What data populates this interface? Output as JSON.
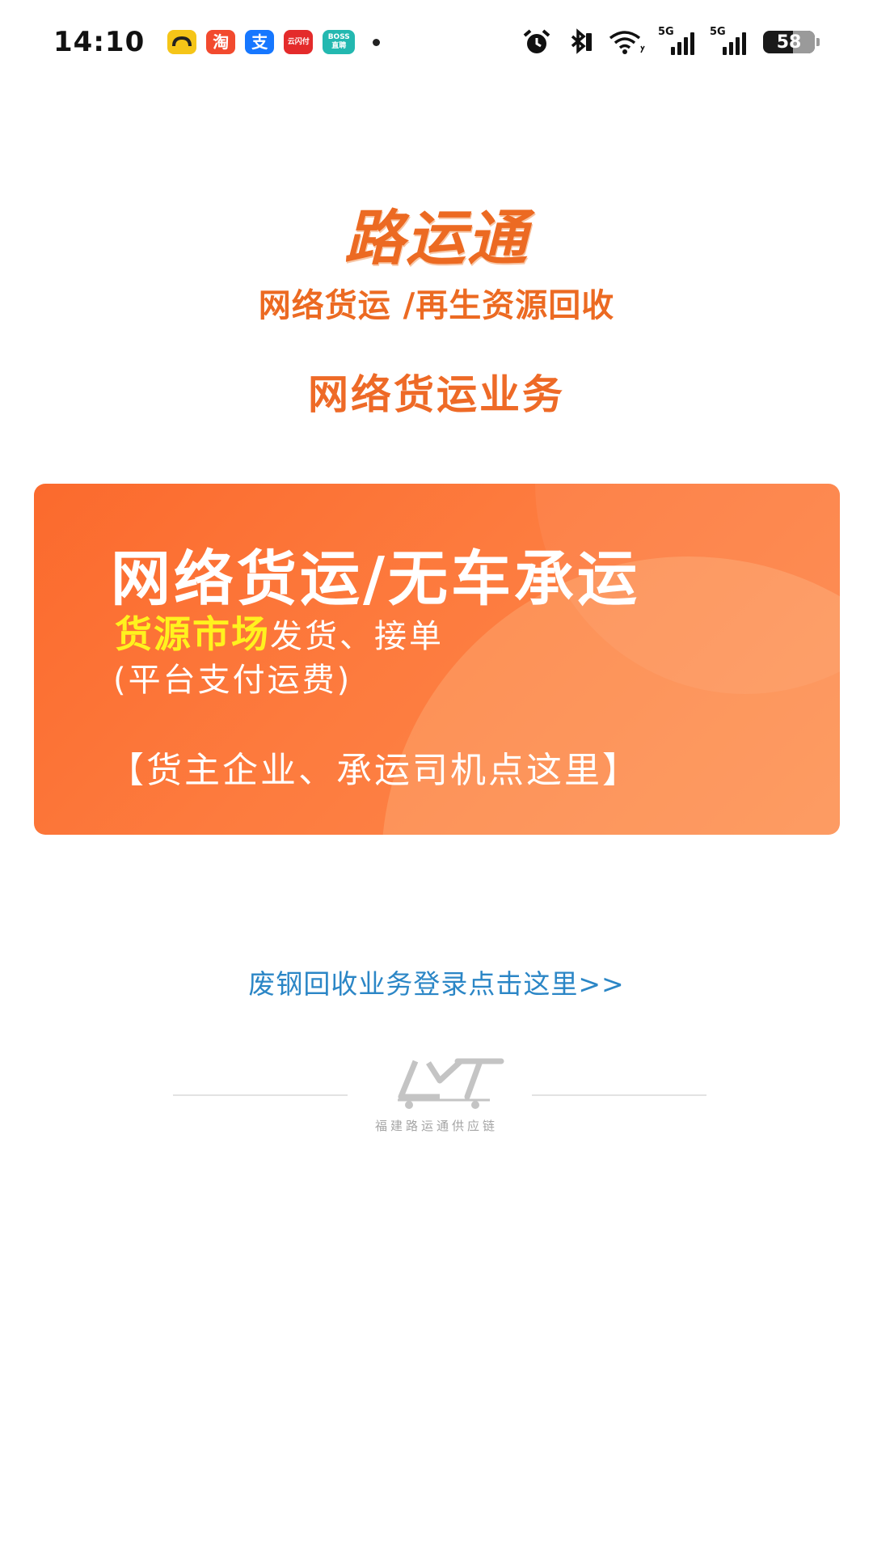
{
  "status_bar": {
    "time": "14:10",
    "apps": [
      {
        "name": "taxi-app-icon",
        "label": "",
        "color": "#f5c518"
      },
      {
        "name": "taobao-icon",
        "label": "淘",
        "color": "#f24a2e"
      },
      {
        "name": "alipay-icon",
        "label": "支",
        "color": "#1677ff"
      },
      {
        "name": "yunshanfu-icon",
        "label": "云闪付",
        "color": "#e42b2b"
      },
      {
        "name": "boss-zhipin-icon",
        "label": "BOSS直聘",
        "color": "#23b8b0"
      }
    ],
    "network1": "5G",
    "network2": "5G",
    "battery": "58"
  },
  "header": {
    "brand": "路运通",
    "tagline": "网络货运 /再生资源回收",
    "section_title": "网络货运业务"
  },
  "banner": {
    "line1": "网络货运/无车承运",
    "line2_highlight": "货源市场",
    "line2_rest": "发货、接单",
    "line3": "(平台支付运费)",
    "line4": "【货主企业、承运司机点这里】"
  },
  "scrap_link": "废钢回收业务登录点击这里>>",
  "footer": {
    "company": "福建路运通供应链",
    "logo": "LYT"
  },
  "colors": {
    "brand_orange": "#ec6a22",
    "banner_orange": "#fd7b3e",
    "highlight_yellow": "#fff21e",
    "link_blue": "#2b86c6"
  }
}
